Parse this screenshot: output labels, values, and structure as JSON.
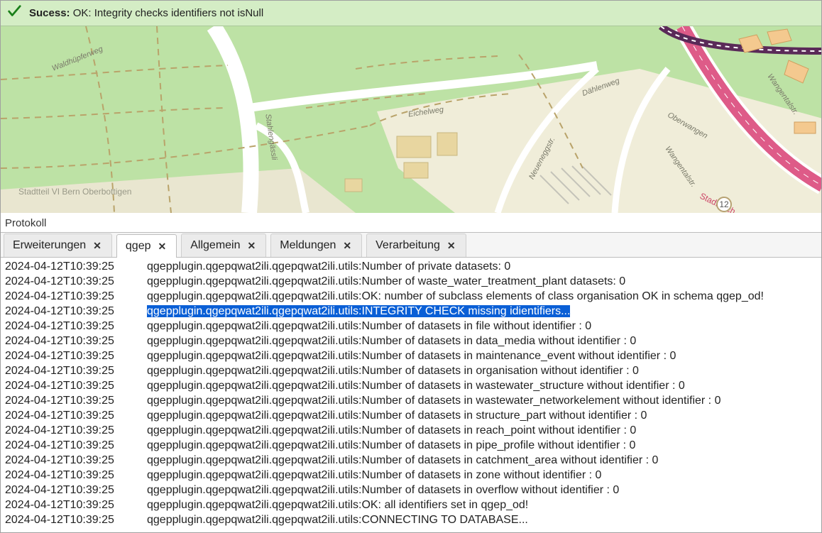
{
  "banner": {
    "label": "Sucess:",
    "message": "OK: Integrity checks identifiers not isNull"
  },
  "panel": {
    "title": "Protokoll"
  },
  "map": {
    "labels": [
      "Waldhüpferweg",
      "Eichelweg",
      "Dählenweg",
      "Oberwangen",
      "Wangentalstr.",
      "Wangentalstr.",
      "Neueneggstr.",
      "Stahlengässli",
      "Stadtteil VI  Bern  Oberbottigen",
      "Stadtbach"
    ],
    "marker": "12"
  },
  "tabs": [
    {
      "label": "Erweiterungen",
      "active": false
    },
    {
      "label": "qgep",
      "active": true
    },
    {
      "label": "Allgemein",
      "active": false
    },
    {
      "label": "Meldungen",
      "active": false
    },
    {
      "label": "Verarbeitung",
      "active": false
    }
  ],
  "log": {
    "prefix": "qgepplugin.qgepqwat2ili.qgepqwat2ili.utils:",
    "entries": [
      {
        "ts": "2024-04-12T10:39:25",
        "msg": "Number of private datasets: 0",
        "selected": false
      },
      {
        "ts": "2024-04-12T10:39:25",
        "msg": "Number of waste_water_treatment_plant datasets: 0",
        "selected": false
      },
      {
        "ts": "2024-04-12T10:39:25",
        "msg": "OK: number of subclass elements of class organisation OK in schema qgep_od!",
        "selected": false
      },
      {
        "ts": "2024-04-12T10:39:25",
        "msg": "INTEGRITY CHECK missing idientifiers...",
        "selected": true
      },
      {
        "ts": "2024-04-12T10:39:25",
        "msg": "Number of datasets in file without identifier : 0",
        "selected": false
      },
      {
        "ts": "2024-04-12T10:39:25",
        "msg": "Number of datasets in data_media without identifier : 0",
        "selected": false
      },
      {
        "ts": "2024-04-12T10:39:25",
        "msg": "Number of datasets in maintenance_event without identifier : 0",
        "selected": false
      },
      {
        "ts": "2024-04-12T10:39:25",
        "msg": "Number of datasets in organisation without identifier : 0",
        "selected": false
      },
      {
        "ts": "2024-04-12T10:39:25",
        "msg": "Number of datasets in wastewater_structure without identifier : 0",
        "selected": false
      },
      {
        "ts": "2024-04-12T10:39:25",
        "msg": "Number of datasets in wastewater_networkelement without identifier : 0",
        "selected": false
      },
      {
        "ts": "2024-04-12T10:39:25",
        "msg": "Number of datasets in structure_part without identifier : 0",
        "selected": false
      },
      {
        "ts": "2024-04-12T10:39:25",
        "msg": "Number of datasets in reach_point without identifier : 0",
        "selected": false
      },
      {
        "ts": "2024-04-12T10:39:25",
        "msg": "Number of datasets in pipe_profile without identifier : 0",
        "selected": false
      },
      {
        "ts": "2024-04-12T10:39:25",
        "msg": "Number of datasets in catchment_area without identifier : 0",
        "selected": false
      },
      {
        "ts": "2024-04-12T10:39:25",
        "msg": "Number of datasets in zone without identifier : 0",
        "selected": false
      },
      {
        "ts": "2024-04-12T10:39:25",
        "msg": "Number of datasets in overflow without identifier : 0",
        "selected": false
      },
      {
        "ts": "2024-04-12T10:39:25",
        "msg": "OK: all identifiers set in qgep_od!",
        "selected": false
      },
      {
        "ts": "2024-04-12T10:39:25",
        "msg": "CONNECTING TO DATABASE...",
        "selected": false
      }
    ]
  }
}
